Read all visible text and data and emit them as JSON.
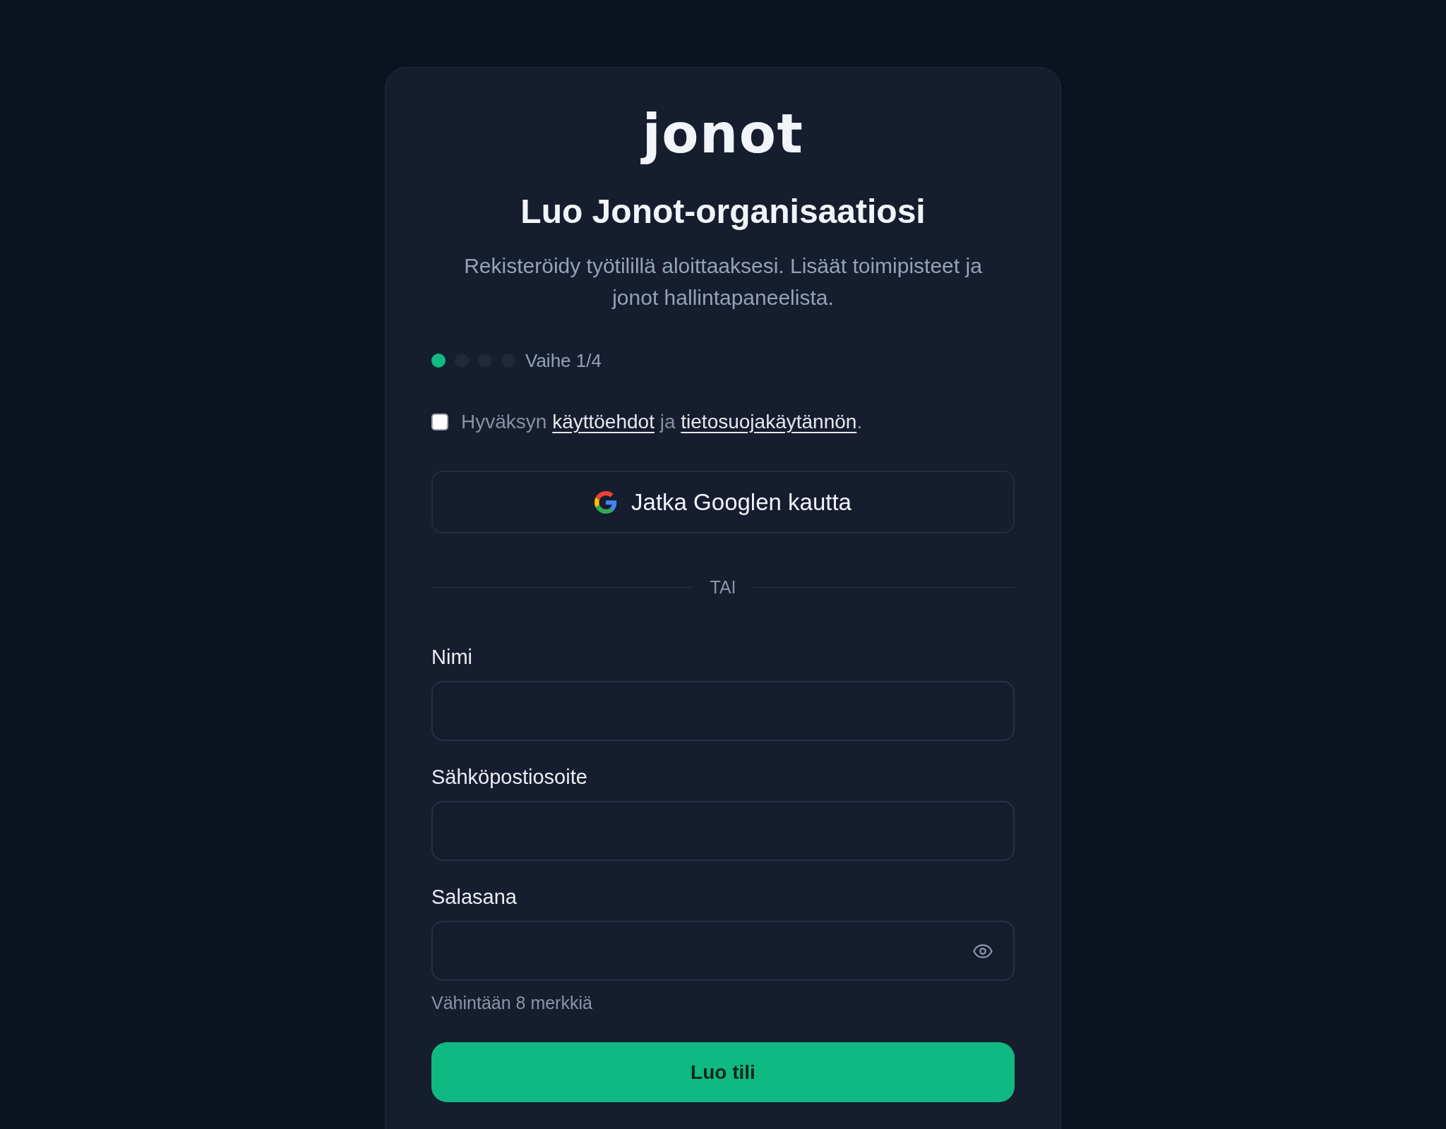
{
  "logo": {
    "text": "jonot"
  },
  "title": "Luo Jonot-organisaatiosi",
  "subtitle": "Rekisteröidy työtilillä aloittaaksesi. Lisäät toimipisteet ja jonot hallintapaneelista.",
  "progress": {
    "dots": [
      {
        "selected": true
      },
      {
        "selected": false
      },
      {
        "selected": false
      },
      {
        "selected": false
      }
    ],
    "label": "Vaihe 1/4"
  },
  "terms": {
    "checked": false,
    "parts": [
      {
        "kind": "text",
        "text": "Hyväksyn "
      },
      {
        "kind": "link",
        "text": "käyttöehdot"
      },
      {
        "kind": "text",
        "text": " ja "
      },
      {
        "kind": "link",
        "text": "tietosuojakäytännön"
      },
      {
        "kind": "text",
        "text": "."
      }
    ]
  },
  "google_button": {
    "label": "Jatka Googlen kautta"
  },
  "divider": {
    "label": "TAI"
  },
  "fields": [
    {
      "kind": "text",
      "label": "Nimi"
    },
    {
      "kind": "email",
      "label": "Sähköpostiosoite"
    },
    {
      "kind": "password",
      "label": "Salasana",
      "hint": "Vähintään 8 merkkiä"
    }
  ],
  "submit_button": {
    "label": "Luo tili"
  }
}
